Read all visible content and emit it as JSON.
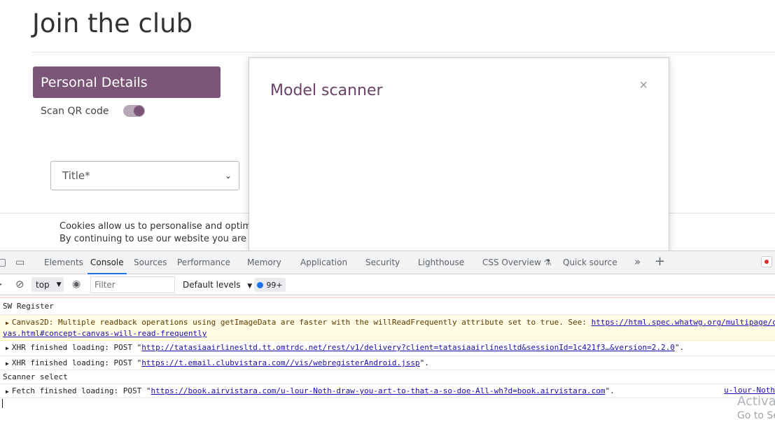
{
  "page": {
    "title": "Join the club",
    "section_header": "Personal Details",
    "scan_qr_label": "Scan QR code",
    "title_select_value": "Title*",
    "cookie_line1": "Cookies allow us to personalise and optimise",
    "cookie_line2": "By continuing to use our website you are agr"
  },
  "modal": {
    "title": "Model scanner",
    "close_glyph": "×"
  },
  "devtools": {
    "tabs": [
      "Elements",
      "Console",
      "Sources",
      "Performance",
      "Memory",
      "Application",
      "Security",
      "Lighthouse",
      "CSS Overview",
      "Quick source"
    ],
    "active_tab": "Console",
    "context": "top",
    "filter_placeholder": "Filter",
    "levels": "Default levels",
    "message_count": "99+",
    "messages": [
      {
        "text": "SW Register"
      },
      {
        "prefix": "Canvas2D: Multiple readback operations using getImageData are faster with the willReadFrequently attribute set to true. See: ",
        "link": "https://html.spec.whatwg.org/multipage/c",
        "line2": "vas.html#concept-canvas-will-read-frequently"
      },
      {
        "prefix": "XHR finished loading: POST \"",
        "link": "http://tatasiaairlinesltd.tt.omtrdc.net/rest/v1/delivery?client=tatasiaairlinesltd&sessionId=1c421f3…&version=2.2.0",
        "suffix": "\"."
      },
      {
        "prefix": "XHR finished loading: POST \"",
        "link": "https://t.email.clubvistara.com//vis/webregisterAndroid.jssp",
        "suffix": "\"."
      },
      {
        "text": "Scanner select"
      },
      {
        "prefix": "Fetch finished loading: POST \"",
        "link": "https://book.airvistara.com/u-lour-Noth-draw-you-art-to-that-a-so-doe-All-wh?d=book.airvistara.com",
        "suffix": "\".",
        "source": "u-lour-Noth"
      }
    ]
  },
  "watermark": {
    "line1": "Activa",
    "line2": "Go to Se"
  },
  "colors": {
    "brand_purple": "#7a5577",
    "modal_title": "#6a4266",
    "devtools_accent": "#1a73e8"
  }
}
